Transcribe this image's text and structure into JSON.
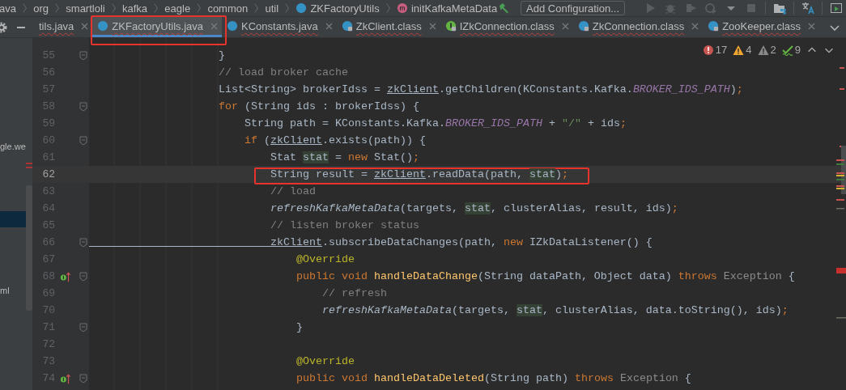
{
  "breadcrumbs": [
    {
      "label": "ava",
      "kind": "folder"
    },
    {
      "label": "org",
      "kind": "folder"
    },
    {
      "label": "smartloli",
      "kind": "folder"
    },
    {
      "label": "kafka",
      "kind": "folder"
    },
    {
      "label": "eagle",
      "kind": "folder"
    },
    {
      "label": "common",
      "kind": "folder"
    },
    {
      "label": "util",
      "kind": "folder"
    },
    {
      "label": "ZKFactoryUtils",
      "kind": "class"
    },
    {
      "label": "initKafkaMetaData",
      "kind": "method"
    }
  ],
  "run_config": {
    "label": "Add Configuration..."
  },
  "tabs": [
    {
      "label": "tils.java",
      "kind": "plain",
      "selected": false,
      "framed": false
    },
    {
      "label": "ZKFactoryUtils.java",
      "kind": "class",
      "selected": true,
      "framed": true
    },
    {
      "label": "KConstants.java",
      "kind": "class",
      "selected": false,
      "framed": false
    },
    {
      "label": "ZkClient.class",
      "kind": "locked-class",
      "selected": false,
      "framed": false
    },
    {
      "label": "IZkConnection.class",
      "kind": "locked-interface",
      "selected": false,
      "framed": false
    },
    {
      "label": "ZkConnection.class",
      "kind": "locked-class",
      "selected": false,
      "framed": false
    },
    {
      "label": "ZooKeeper.class",
      "kind": "locked-class",
      "selected": false,
      "framed": false
    }
  ],
  "project_panel": {
    "items": [
      {
        "label": "gle.we",
        "selected": false
      },
      {
        "selected": true
      },
      {
        "label": "ml",
        "selected": false
      }
    ]
  },
  "inspections": [
    {
      "kind": "error",
      "count": "17"
    },
    {
      "kind": "warning",
      "count": "4"
    },
    {
      "kind": "weak",
      "count": "2"
    },
    {
      "kind": "typo",
      "count": "9"
    }
  ],
  "code_lines": [
    {
      "number": "55",
      "fold": true,
      "current": false,
      "framed": false,
      "tokens": [
        {
          "t": "                    }",
          "kind": "p"
        }
      ]
    },
    {
      "number": "56",
      "fold": false,
      "current": false,
      "framed": false,
      "tokens": [
        {
          "t": "                    // load broker cache",
          "kind": "c"
        }
      ]
    },
    {
      "number": "57",
      "fold": false,
      "current": false,
      "framed": false,
      "tokens": [
        {
          "t": "                    List<String> brokerIdss = ",
          "kind": "p"
        },
        {
          "t": "zkClient",
          "kind": "m"
        },
        {
          "t": ".getChildren(KConstants.Kafka.",
          "kind": "p"
        },
        {
          "t": "BROKER_IDS_PATH",
          "kind": "f"
        },
        {
          "t": ")",
          "kind": "p"
        },
        {
          "t": ";",
          "kind": "k"
        }
      ]
    },
    {
      "number": "58",
      "fold": true,
      "current": false,
      "framed": false,
      "tokens": [
        {
          "t": "                    for",
          "kind": "k"
        },
        {
          "t": " (String ids : brokerIdss) {",
          "kind": "p"
        }
      ]
    },
    {
      "number": "59",
      "fold": false,
      "current": false,
      "framed": false,
      "tokens": [
        {
          "t": "                        String path = KConstants.Kafka.",
          "kind": "p"
        },
        {
          "t": "BROKER_IDS_PATH",
          "kind": "f"
        },
        {
          "t": " + ",
          "kind": "p"
        },
        {
          "t": "\"/\"",
          "kind": "s"
        },
        {
          "t": " + ids",
          "kind": "p"
        },
        {
          "t": ";",
          "kind": "k"
        }
      ]
    },
    {
      "number": "60",
      "fold": true,
      "current": false,
      "framed": false,
      "tokens": [
        {
          "t": "                        if",
          "kind": "k"
        },
        {
          "t": " (",
          "kind": "p"
        },
        {
          "t": "zkClient",
          "kind": "m"
        },
        {
          "t": ".exists(path)) {",
          "kind": "p"
        }
      ]
    },
    {
      "number": "61",
      "fold": false,
      "current": false,
      "framed": false,
      "tokens": [
        {
          "t": "                            Stat ",
          "kind": "p"
        },
        {
          "t": "stat",
          "kind": "h"
        },
        {
          "t": " = ",
          "kind": "p"
        },
        {
          "t": "new",
          "kind": "k"
        },
        {
          "t": " Stat()",
          "kind": "p"
        },
        {
          "t": ";",
          "kind": "k"
        }
      ]
    },
    {
      "number": "62",
      "fold": false,
      "current": true,
      "framed": true,
      "tokens": [
        {
          "t": "                            String result = ",
          "kind": "p"
        },
        {
          "t": "zkClient",
          "kind": "m"
        },
        {
          "t": ".readData(path, ",
          "kind": "p"
        },
        {
          "t": "stat",
          "kind": "h"
        },
        {
          "t": ")",
          "kind": "p"
        },
        {
          "t": ";",
          "kind": "k"
        }
      ]
    },
    {
      "number": "63",
      "fold": false,
      "current": false,
      "framed": false,
      "tokens": [
        {
          "t": "                            // load",
          "kind": "c"
        }
      ]
    },
    {
      "number": "64",
      "fold": false,
      "current": false,
      "framed": false,
      "tokens": [
        {
          "t": "                            refreshKafkaMetaData",
          "kind": "i"
        },
        {
          "t": "(targets, ",
          "kind": "p"
        },
        {
          "t": "stat",
          "kind": "h"
        },
        {
          "t": ", clusterAlias, result, ids)",
          "kind": "p"
        },
        {
          "t": ";",
          "kind": "k"
        }
      ]
    },
    {
      "number": "65",
      "fold": false,
      "current": false,
      "framed": false,
      "tokens": [
        {
          "t": "                            // listen broker status",
          "kind": "c"
        }
      ]
    },
    {
      "number": "66",
      "fold": true,
      "current": false,
      "framed": false,
      "tokens": [
        {
          "t": "                            zkClient",
          "kind": "m"
        },
        {
          "t": ".subscribeDataChanges(path, ",
          "kind": "p"
        },
        {
          "t": "new",
          "kind": "k"
        },
        {
          "t": " IZkDataListener() {",
          "kind": "p"
        }
      ]
    },
    {
      "number": "67",
      "fold": false,
      "current": false,
      "framed": false,
      "tokens": [
        {
          "t": "                                @Override",
          "kind": "a"
        }
      ]
    },
    {
      "number": "68",
      "fold": true,
      "current": false,
      "framed": false,
      "gutter_icon": {
        "kind": "implements"
      },
      "tokens": [
        {
          "t": "                                public void ",
          "kind": "k"
        },
        {
          "t": "handleDataChange",
          "kind": "d"
        },
        {
          "t": "(String dataPath, Object data) ",
          "kind": "p"
        },
        {
          "t": "throws",
          "kind": "k"
        },
        {
          "t": " Exception",
          "kind": "x"
        },
        {
          "t": " {",
          "kind": "p"
        }
      ]
    },
    {
      "number": "69",
      "fold": false,
      "current": false,
      "framed": false,
      "tokens": [
        {
          "t": "                                    // refresh",
          "kind": "c"
        }
      ]
    },
    {
      "number": "70",
      "fold": false,
      "current": false,
      "framed": false,
      "tokens": [
        {
          "t": "                                    refreshKafkaMetaData",
          "kind": "i"
        },
        {
          "t": "(targets, ",
          "kind": "p"
        },
        {
          "t": "stat",
          "kind": "h"
        },
        {
          "t": ", clusterAlias, data.toString(), ids)",
          "kind": "p"
        },
        {
          "t": ";",
          "kind": "k"
        }
      ]
    },
    {
      "number": "71",
      "fold": true,
      "current": false,
      "framed": false,
      "tokens": [
        {
          "t": "                                }",
          "kind": "p"
        }
      ]
    },
    {
      "number": "72",
      "fold": false,
      "current": false,
      "framed": false
    },
    {
      "number": "73",
      "fold": false,
      "current": false,
      "framed": false,
      "tokens": [
        {
          "t": "                                @Override",
          "kind": "a"
        }
      ]
    },
    {
      "number": "74",
      "fold": true,
      "current": false,
      "framed": false,
      "gutter_icon": {
        "kind": "implements"
      },
      "tokens": [
        {
          "t": "                                public void ",
          "kind": "k"
        },
        {
          "t": "handleDataDeleted",
          "kind": "d"
        },
        {
          "t": "(String path) ",
          "kind": "p"
        },
        {
          "t": "throws",
          "kind": "k"
        },
        {
          "t": " Exception",
          "kind": "x"
        },
        {
          "t": " {",
          "kind": "p"
        }
      ]
    }
  ]
}
